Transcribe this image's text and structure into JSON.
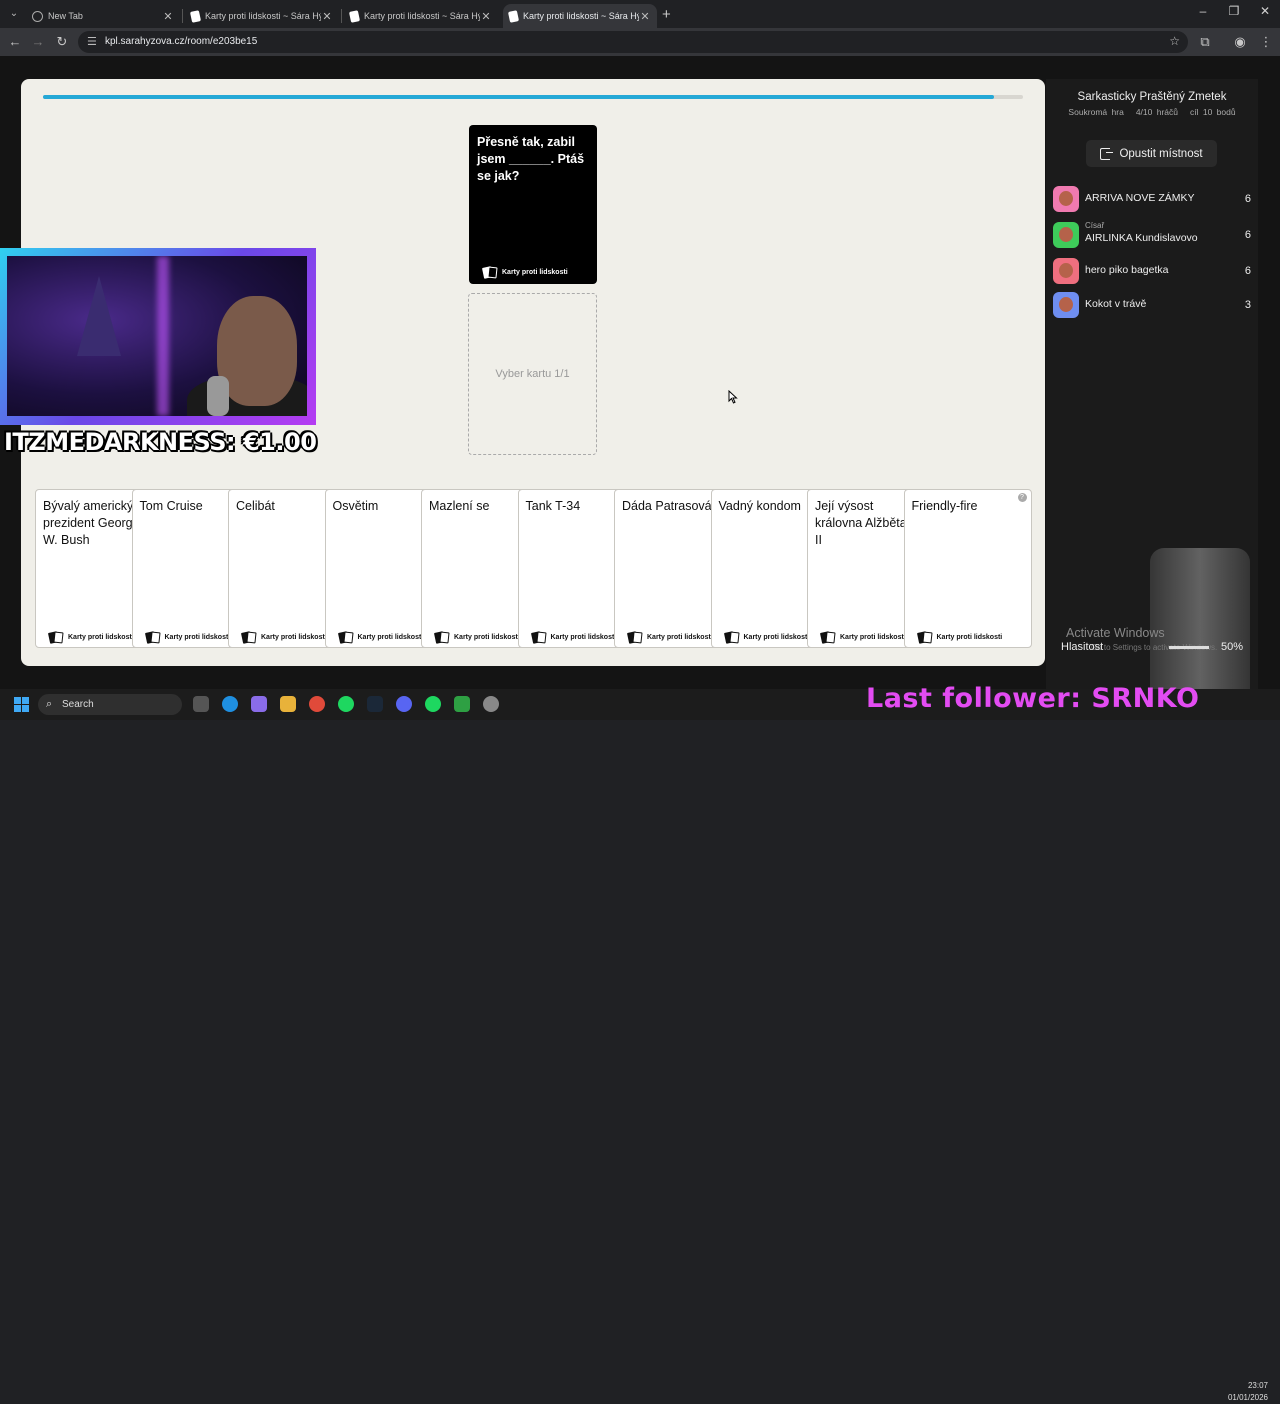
{
  "browser": {
    "tabs": [
      {
        "title": "New Tab",
        "favicon": "globe-icon",
        "active": false
      },
      {
        "title": "Karty proti lidskosti ~ Sára Hýžová",
        "favicon": "card-icon",
        "active": false
      },
      {
        "title": "Karty proti lidskosti ~ Sára Hýžová",
        "favicon": "card-icon",
        "active": false
      },
      {
        "title": "Karty proti lidskosti ~ Sára Hýžová",
        "favicon": "card-icon",
        "active": true
      }
    ],
    "close_glyph": "✕",
    "new_tab_glyph": "+",
    "url": "kpl.sarahyzova.cz/room/e203be15"
  },
  "game": {
    "progress_fraction": 0.97,
    "black_card": {
      "text": "Přesně tak, zabil jsem ______. Ptáš se jak?",
      "logo": "Karty proti lidskosti"
    },
    "slot_label": "Vyber kartu 1/1",
    "hand": [
      {
        "text": "Bývalý americký prezident George W. Bush",
        "logo": "Karty proti lidskosti"
      },
      {
        "text": "Tom Cruise",
        "logo": "Karty proti lidskosti"
      },
      {
        "text": "Celibát",
        "logo": "Karty proti lidskosti"
      },
      {
        "text": "Osvětim",
        "logo": "Karty proti lidskosti"
      },
      {
        "text": "Mazlení se",
        "logo": "Karty proti lidskosti"
      },
      {
        "text": "Tank T-34",
        "logo": "Karty proti lidskosti"
      },
      {
        "text": "Dáda Patrasová",
        "logo": "Karty proti lidskosti"
      },
      {
        "text": "Vadný kondom",
        "logo": "Karty proti lidskosti"
      },
      {
        "text": "Její výsost královna Alžběta II",
        "logo": "Karty proti lidskosti"
      },
      {
        "text": "Friendly-fire",
        "logo": "Karty proti lidskosti"
      }
    ],
    "help_glyph": "?"
  },
  "sidebar": {
    "room_name": "Sarkasticky Praštěný Zmetek",
    "meta": [
      "Soukromá hra",
      "4/10 hráčů",
      "cíl 10 bodů"
    ],
    "leave_label": "Opustit místnost",
    "players": [
      {
        "name": "ARRIVA NOVE ZÁMKY",
        "tag": "",
        "score": "6",
        "avatar_color": "#f07ab0"
      },
      {
        "name": "AIRLINKA Kundislavovo",
        "tag": "Císař",
        "score": "6",
        "avatar_color": "#3ecb5a"
      },
      {
        "name": "hero piko bagetka",
        "tag": "",
        "score": "6",
        "avatar_color": "#ef6f7f"
      },
      {
        "name": "Kokot v trávě",
        "tag": "",
        "score": "3",
        "avatar_color": "#6f8ef0"
      }
    ]
  },
  "overlay": {
    "donation": "ITZMEDARKNESS: €1.00",
    "last_follower": "Last follower: SRNKO",
    "activate_windows": "Activate Windows",
    "activate_sub": "Go to Settings to activate Windows.",
    "volume_label": "Hlasitost",
    "volume_pct": "50%"
  },
  "taskbar": {
    "search_label": "Search",
    "time": "23:07",
    "date": "01/01/2026"
  }
}
